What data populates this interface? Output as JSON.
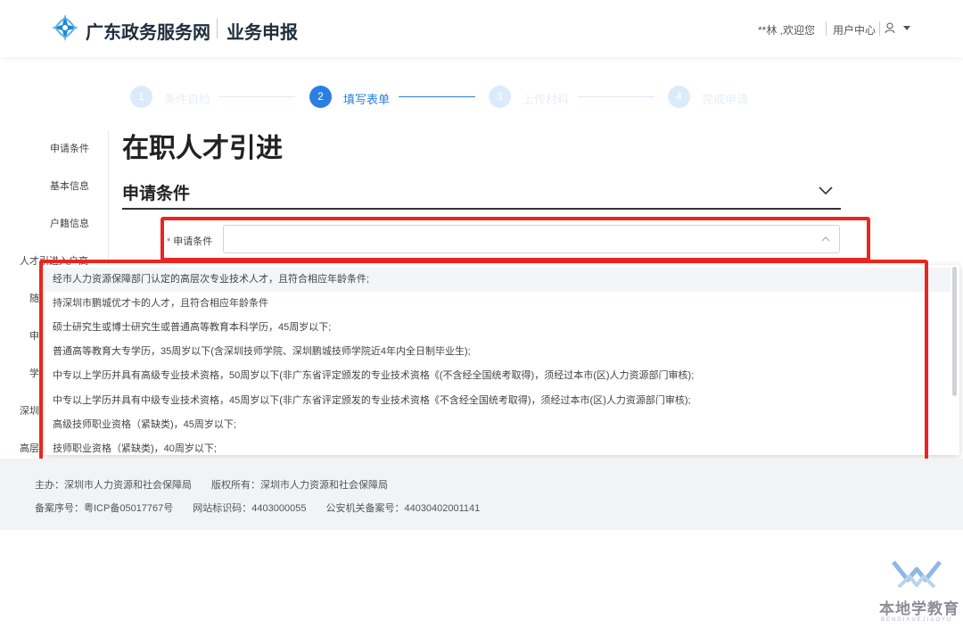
{
  "header": {
    "brand": "广东政务服务网",
    "sub_title": "业务申报",
    "welcome": "**林 ,欢迎您",
    "user_center": "用户中心"
  },
  "steps": [
    {
      "num": "1",
      "label": "条件自检",
      "active": false
    },
    {
      "num": "2",
      "label": "填写表单",
      "active": true
    },
    {
      "num": "3",
      "label": "上传材料",
      "active": false
    },
    {
      "num": "4",
      "label": "完成申请",
      "active": false
    }
  ],
  "side_nav": [
    "申请条件",
    "基本信息",
    "户籍信息",
    "人才引进入户高",
    "随",
    "申",
    "学",
    "深圳",
    "高层"
  ],
  "main": {
    "page_title": "在职人才引进",
    "section_title": "申请条件",
    "field_label": "申请条件",
    "field_value": ""
  },
  "dropdown_options": [
    "经市人力资源保障部门认定的高层次专业技术人才，且符合相应年龄条件;",
    "持深圳市鹏城优才卡的人才，且符合相应年龄条件",
    "硕士研究生或博士研究生或普通高等教育本科学历，45周岁以下;",
    "普通高等教育大专学历，35周岁以下(含深圳技师学院、深圳鹏城技师学院近4年内全日制毕业生);",
    "中专以上学历并具有高级专业技术资格，50周岁以下(非广东省评定颁发的专业技术资格《(不含经全国统考取得)，须经过本市(区)人力资源部门审核);",
    "中专以上学历并具有中级专业技术资格，45周岁以下(非广东省评定颁发的专业技术资格《不含经全国统考取得)，须经过本市(区)人力资源部门审核);",
    "高级技师职业资格（紧缺类)，45周岁以下;",
    "技师职业资格（紧缺类)，40周岁以下;"
  ],
  "footer": {
    "line1": "主办：深圳市人力资源和社会保障局　　版权所有：深圳市人力资源和社会保障局",
    "line2": "备案序号：粤ICP备05017767号　　网站标识码：4403000055　　公安机关备案号：44030402001141"
  },
  "watermark": {
    "text": "本地学教育",
    "sub": "BENDIXUEJIAOYU"
  },
  "colors": {
    "accent": "#2b7fe0",
    "highlight": "#e8261f"
  }
}
